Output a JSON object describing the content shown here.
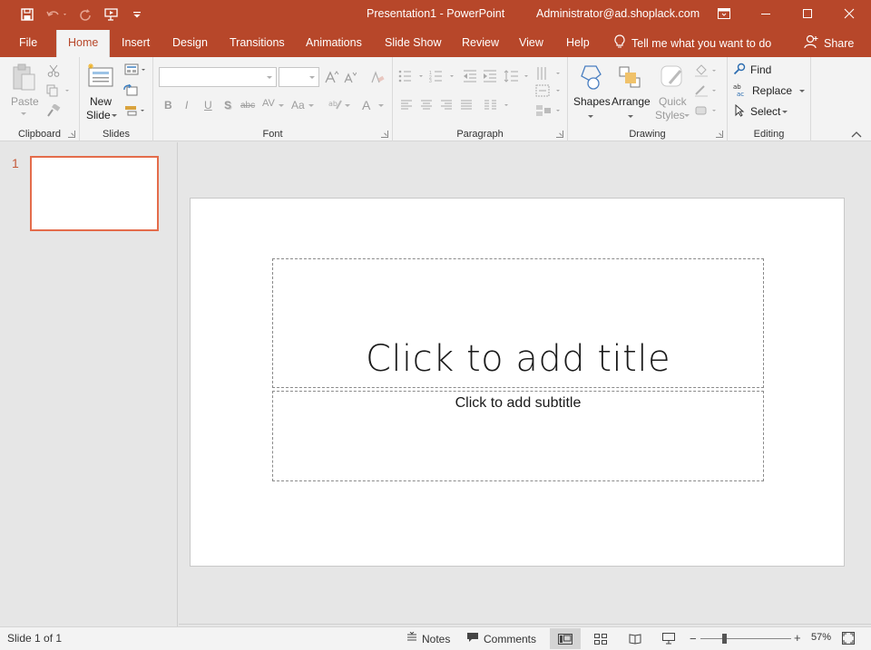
{
  "window": {
    "document_title": "Presentation1  -  PowerPoint",
    "user": "Administrator@ad.shoplack.com"
  },
  "tabs": [
    {
      "label": "File"
    },
    {
      "label": "Home",
      "active": true
    },
    {
      "label": "Insert"
    },
    {
      "label": "Design"
    },
    {
      "label": "Transitions"
    },
    {
      "label": "Animations"
    },
    {
      "label": "Slide Show"
    },
    {
      "label": "Review"
    },
    {
      "label": "View"
    },
    {
      "label": "Help"
    }
  ],
  "tell_me": "Tell me what you want to do",
  "share": "Share",
  "ribbon": {
    "clipboard": {
      "label": "Clipboard",
      "paste": "Paste"
    },
    "slides": {
      "label": "Slides",
      "new_slide_line1": "New",
      "new_slide_line2": "Slide"
    },
    "font": {
      "label": "Font",
      "font_name": "",
      "font_size": ""
    },
    "paragraph": {
      "label": "Paragraph"
    },
    "drawing": {
      "label": "Drawing",
      "shapes": "Shapes",
      "arrange": "Arrange",
      "quick_styles_line1": "Quick",
      "quick_styles_line2": "Styles"
    },
    "editing": {
      "label": "Editing",
      "find": "Find",
      "replace": "Replace",
      "select": "Select"
    }
  },
  "thumbnails": [
    {
      "number": "1"
    }
  ],
  "slide": {
    "title_placeholder": "Click to add title",
    "subtitle_placeholder": "Click to add subtitle"
  },
  "status": {
    "slide_counter": "Slide 1 of 1",
    "notes": "Notes",
    "comments": "Comments",
    "zoom": "57%",
    "zoom_fraction": 0.57
  },
  "colors": {
    "accent": "#b7472a",
    "thumb_border": "#e46c4b"
  },
  "icons": [
    "save-icon",
    "undo-icon",
    "redo-icon",
    "start-from-beginning-icon",
    "customize-qat-icon",
    "ribbon-display-options-icon",
    "minimize-icon",
    "maximize-icon",
    "close-icon",
    "lightbulb-icon",
    "person-icon",
    "paste-icon",
    "cut-icon",
    "copy-icon",
    "format-painter-icon",
    "new-slide-icon",
    "layout-icon",
    "reset-icon",
    "section-icon",
    "find-icon",
    "replace-icon",
    "select-icon",
    "notes-icon",
    "comments-icon",
    "normal-view-icon",
    "slide-sorter-icon",
    "reading-view-icon",
    "slide-show-icon",
    "fit-slide-icon"
  ]
}
